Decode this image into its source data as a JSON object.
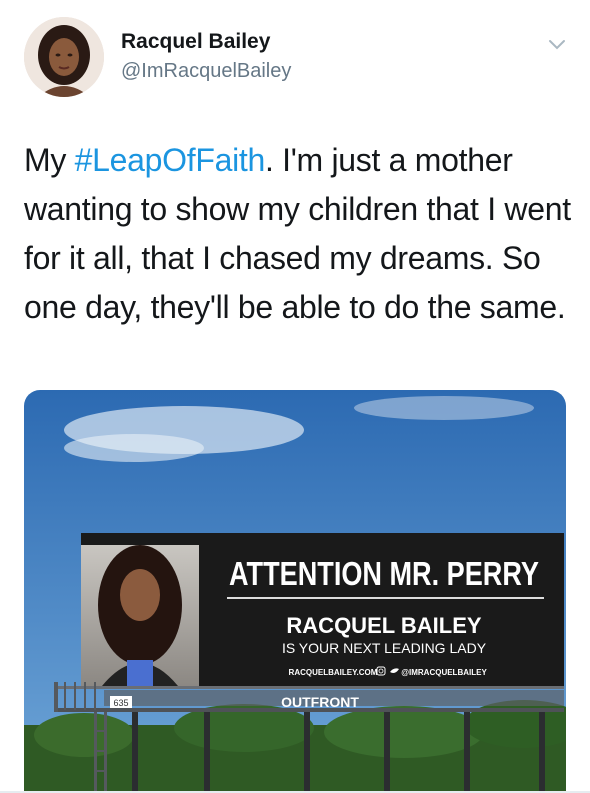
{
  "tweet": {
    "author_name": "Racquel Bailey",
    "author_handle": "@ImRacquelBailey",
    "text_before": "My ",
    "hashtag": "#LeapOfFaith",
    "text_after": ". I'm just a mother wanting to show my children that I went for it all, that I chased my dreams. So one day, they'll be able to do the same."
  },
  "billboard": {
    "headline": "ATTENTION MR. PERRY",
    "name": "RACQUEL BAILEY",
    "subline": "IS YOUR NEXT LEADING LADY",
    "footer_site": "RACQUELBAILEY.COM",
    "footer_handle": "@IMRACQUELBAILEY",
    "panel_number": "635",
    "operator": "OUTFRONT"
  },
  "icons": {
    "caret": "chevron-down-icon",
    "instagram": "instagram-icon",
    "twitter": "twitter-icon"
  },
  "colors": {
    "hashtag": "#1b95e0",
    "name": "#14171a",
    "handle": "#657786",
    "sky_top": "#2c6ab2",
    "sky_bottom": "#6fa6d8",
    "billboard_bg": "#1a1a1a"
  }
}
